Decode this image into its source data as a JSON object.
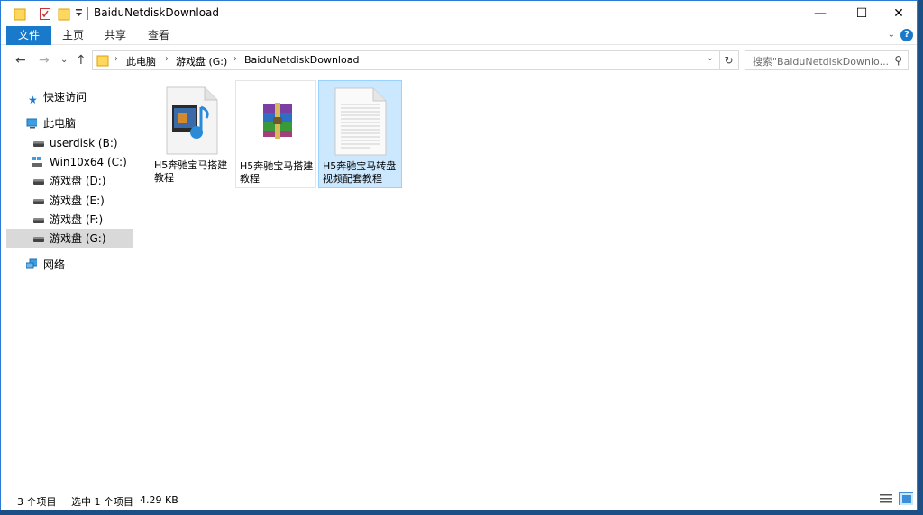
{
  "window": {
    "title": "BaiduNetdiskDownload"
  },
  "title_buttons": {
    "minimize": "—",
    "maximize": "☐",
    "close": "✕"
  },
  "ribbon": {
    "tabs": [
      "文件",
      "主页",
      "共享",
      "查看"
    ],
    "help": "?"
  },
  "address": {
    "crumbs": [
      "此电脑",
      "游戏盘 (G:)",
      "BaiduNetdiskDownload"
    ],
    "search_placeholder": "搜索\"BaiduNetdiskDownlo...\"",
    "search_icon": "search-icon",
    "refresh_icon": "refresh-icon"
  },
  "sidebar": {
    "items": [
      {
        "label": "快速访问",
        "icon": "star-icon"
      },
      {
        "label": "此电脑",
        "icon": "computer-icon"
      },
      {
        "label": "userdisk (B:)",
        "icon": "drive-icon"
      },
      {
        "label": "Win10x64 (C:)",
        "icon": "windows-drive-icon"
      },
      {
        "label": "游戏盘 (D:)",
        "icon": "drive-icon"
      },
      {
        "label": "游戏盘 (E:)",
        "icon": "drive-icon"
      },
      {
        "label": "游戏盘 (F:)",
        "icon": "drive-icon"
      },
      {
        "label": "游戏盘 (G:)",
        "icon": "drive-icon",
        "selected": true
      },
      {
        "label": "网络",
        "icon": "network-icon"
      }
    ]
  },
  "files": [
    {
      "name": "H5奔驰宝马搭建教程",
      "type": "video-file-icon"
    },
    {
      "name": "H5奔驰宝马搭建教程",
      "type": "winrar-archive-icon"
    },
    {
      "name": "H5奔驰宝马转盘视频配套教程",
      "type": "text-document-icon",
      "selected": true
    }
  ],
  "status": {
    "count": "3 个项目",
    "selected": "选中 1 个项目",
    "size": "4.29 KB"
  },
  "colors": {
    "accent": "#1979ca",
    "selection": "#cce8ff",
    "sidebar_selected": "#d9d9d9"
  }
}
